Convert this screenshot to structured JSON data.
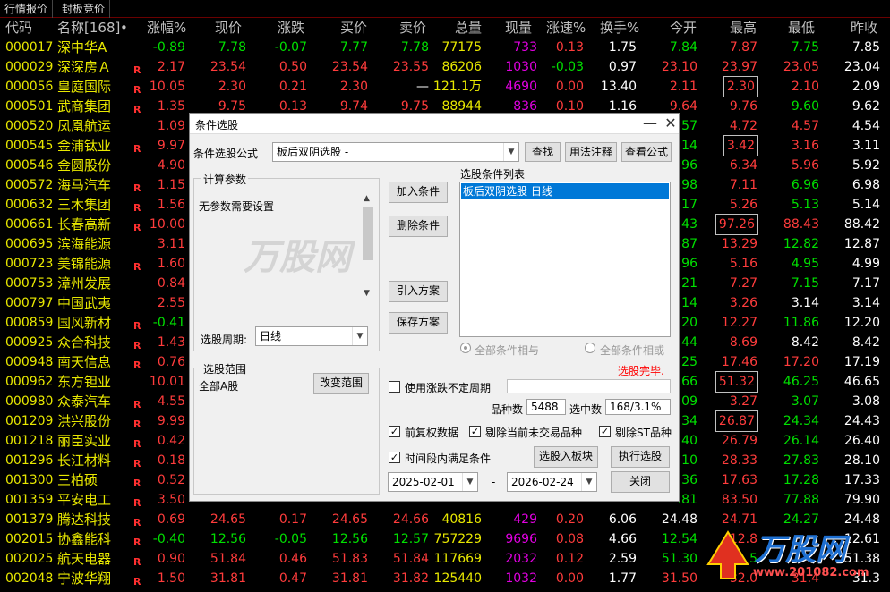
{
  "tabs": [
    "行情报价",
    "封板竞价"
  ],
  "columns": [
    "代码",
    "名称[168]",
    "涨幅%",
    "现价",
    "涨跌",
    "买价",
    "卖价",
    "总量",
    "现量",
    "涨速%",
    "换手%",
    "今开",
    "最高",
    "最低",
    "昨收"
  ],
  "name_dot": "•",
  "rows": [
    {
      "code": "000017",
      "name": "深中华A",
      "r": "",
      "chg": "-0.89",
      "price": "7.78",
      "diff": "-0.07",
      "bid": "7.77",
      "ask": "7.78",
      "vol": "77175",
      "cur": "733",
      "speed": "0.13",
      "turn": "1.75",
      "open": "7.84",
      "high": "7.87",
      "low": "7.75",
      "prev": "7.85"
    },
    {
      "code": "000029",
      "name": "深深房Ａ",
      "r": "R",
      "chg": "2.17",
      "price": "23.54",
      "diff": "0.50",
      "bid": "23.54",
      "ask": "23.55",
      "vol": "86206",
      "cur": "1030",
      "speed": "-0.03",
      "turn": "0.97",
      "open": "23.10",
      "high": "23.97",
      "low": "23.05",
      "prev": "23.04"
    },
    {
      "code": "000056",
      "name": "皇庭国际",
      "r": "R",
      "chg": "10.05",
      "price": "2.30",
      "diff": "0.21",
      "bid": "2.30",
      "ask": "—",
      "vol": "121.1万",
      "cur": "4690",
      "speed": "0.00",
      "turn": "13.40",
      "open": "2.11",
      "high": "2.30",
      "low": "2.10",
      "prev": "2.09"
    },
    {
      "code": "000501",
      "name": "武商集团",
      "r": "R",
      "chg": "1.35",
      "price": "9.75",
      "diff": "0.13",
      "bid": "9.74",
      "ask": "9.75",
      "vol": "88944",
      "cur": "836",
      "speed": "0.10",
      "turn": "1.16",
      "open": "9.64",
      "high": "9.76",
      "low": "9.60",
      "prev": "9.62"
    },
    {
      "code": "000520",
      "name": "凤凰航运",
      "r": "",
      "chg": "1.09",
      "price": "",
      "diff": "",
      "bid": "",
      "ask": "",
      "vol": "",
      "cur": "",
      "speed": "",
      "turn": "",
      "open": ".57",
      "high": "4.72",
      "low": "4.57",
      "prev": "4.54"
    },
    {
      "code": "000545",
      "name": "金浦钛业",
      "r": "R",
      "chg": "9.97",
      "price": "",
      "diff": "",
      "bid": "",
      "ask": "",
      "vol": "",
      "cur": "",
      "speed": "",
      "turn": "",
      "open": ".14",
      "high": "3.42",
      "low": "3.16",
      "prev": "3.11"
    },
    {
      "code": "000546",
      "name": "金圆股份",
      "r": "",
      "chg": "4.90",
      "price": "",
      "diff": "",
      "bid": "",
      "ask": "",
      "vol": "",
      "cur": "",
      "speed": "",
      "turn": "",
      "open": ".96",
      "high": "6.34",
      "low": "5.96",
      "prev": "5.92"
    },
    {
      "code": "000572",
      "name": "海马汽车",
      "r": "R",
      "chg": "1.15",
      "price": "",
      "diff": "",
      "bid": "",
      "ask": "",
      "vol": "",
      "cur": "",
      "speed": "",
      "turn": "",
      "open": ".98",
      "high": "7.11",
      "low": "6.96",
      "prev": "6.98"
    },
    {
      "code": "000632",
      "name": "三木集团",
      "r": "R",
      "chg": "1.56",
      "price": "",
      "diff": "",
      "bid": "",
      "ask": "",
      "vol": "",
      "cur": "",
      "speed": "",
      "turn": "",
      "open": ".17",
      "high": "5.26",
      "low": "5.13",
      "prev": "5.14"
    },
    {
      "code": "000661",
      "name": "长春高新",
      "r": "R",
      "chg": "10.00",
      "price": "",
      "diff": "",
      "bid": "",
      "ask": "",
      "vol": "",
      "cur": "",
      "speed": "",
      "turn": "",
      "open": ".43",
      "high": "97.26",
      "low": "88.43",
      "prev": "88.42"
    },
    {
      "code": "000695",
      "name": "滨海能源",
      "r": "",
      "chg": "3.11",
      "price": "",
      "diff": "",
      "bid": "",
      "ask": "",
      "vol": "",
      "cur": "",
      "speed": "",
      "turn": "",
      "open": ".87",
      "high": "13.29",
      "low": "12.82",
      "prev": "12.87"
    },
    {
      "code": "000723",
      "name": "美锦能源",
      "r": "R",
      "chg": "1.60",
      "price": "",
      "diff": "",
      "bid": "",
      "ask": "",
      "vol": "",
      "cur": "",
      "speed": "",
      "turn": "",
      "open": ".96",
      "high": "5.16",
      "low": "4.95",
      "prev": "4.99"
    },
    {
      "code": "000753",
      "name": "漳州发展",
      "r": "",
      "chg": "0.84",
      "price": "",
      "diff": "",
      "bid": "",
      "ask": "",
      "vol": "",
      "cur": "",
      "speed": "",
      "turn": "",
      "open": ".21",
      "high": "7.27",
      "low": "7.15",
      "prev": "7.17"
    },
    {
      "code": "000797",
      "name": "中国武夷",
      "r": "",
      "chg": "2.55",
      "price": "",
      "diff": "",
      "bid": "",
      "ask": "",
      "vol": "",
      "cur": "",
      "speed": "",
      "turn": "",
      "open": ".14",
      "high": "3.26",
      "low": "3.14",
      "prev": "3.14"
    },
    {
      "code": "000859",
      "name": "国风新材",
      "r": "R",
      "chg": "-0.41",
      "price": "",
      "diff": "",
      "bid": "",
      "ask": "",
      "vol": "",
      "cur": "",
      "speed": "",
      "turn": "",
      "open": ".20",
      "high": "12.27",
      "low": "11.86",
      "prev": "12.20"
    },
    {
      "code": "000925",
      "name": "众合科技",
      "r": "R",
      "chg": "1.43",
      "price": "",
      "diff": "",
      "bid": "",
      "ask": "",
      "vol": "",
      "cur": "",
      "speed": "",
      "turn": "",
      "open": ".44",
      "high": "8.69",
      "low": "8.42",
      "prev": "8.42"
    },
    {
      "code": "000948",
      "name": "南天信息",
      "r": "R",
      "chg": "0.76",
      "price": "",
      "diff": "",
      "bid": "",
      "ask": "",
      "vol": "",
      "cur": "",
      "speed": "",
      "turn": "",
      "open": ".25",
      "high": "17.46",
      "low": "17.20",
      "prev": "17.19"
    },
    {
      "code": "000962",
      "name": "东方钽业",
      "r": "",
      "chg": "10.01",
      "price": "",
      "diff": "",
      "bid": "",
      "ask": "",
      "vol": "",
      "cur": "",
      "speed": "",
      "turn": "",
      "open": ".66",
      "high": "51.32",
      "low": "46.25",
      "prev": "46.65"
    },
    {
      "code": "000980",
      "name": "众泰汽车",
      "r": "R",
      "chg": "4.55",
      "price": "",
      "diff": "",
      "bid": "",
      "ask": "",
      "vol": "",
      "cur": "",
      "speed": "",
      "turn": "",
      "open": ".09",
      "high": "3.27",
      "low": "3.07",
      "prev": "3.08"
    },
    {
      "code": "001209",
      "name": "洪兴股份",
      "r": "R",
      "chg": "9.99",
      "price": "",
      "diff": "",
      "bid": "",
      "ask": "",
      "vol": "",
      "cur": "",
      "speed": "",
      "turn": "",
      "open": ".34",
      "high": "26.87",
      "low": "24.34",
      "prev": "24.43"
    },
    {
      "code": "001218",
      "name": "丽臣实业",
      "r": "R",
      "chg": "0.42",
      "price": "",
      "diff": "",
      "bid": "",
      "ask": "",
      "vol": "",
      "cur": "",
      "speed": "",
      "turn": "",
      "open": ".40",
      "high": "26.79",
      "low": "26.14",
      "prev": "26.40"
    },
    {
      "code": "001296",
      "name": "长江材料",
      "r": "R",
      "chg": "0.18",
      "price": "",
      "diff": "",
      "bid": "",
      "ask": "",
      "vol": "",
      "cur": "",
      "speed": "",
      "turn": "",
      "open": ".10",
      "high": "28.33",
      "low": "27.83",
      "prev": "28.10"
    },
    {
      "code": "001300",
      "name": "三柏硕",
      "r": "R",
      "chg": "0.52",
      "price": "",
      "diff": "",
      "bid": "",
      "ask": "",
      "vol": "",
      "cur": "",
      "speed": "",
      "turn": "",
      "open": ".36",
      "high": "17.63",
      "low": "17.28",
      "prev": "17.33"
    },
    {
      "code": "001359",
      "name": "平安电工",
      "r": "R",
      "chg": "3.50",
      "price": "",
      "diff": "",
      "bid": "",
      "ask": "",
      "vol": "",
      "cur": "",
      "speed": "",
      "turn": "",
      "open": ".81",
      "high": "83.50",
      "low": "77.88",
      "prev": "79.90"
    },
    {
      "code": "001379",
      "name": "腾达科技",
      "r": "R",
      "chg": "0.69",
      "price": "24.65",
      "diff": "0.17",
      "bid": "24.65",
      "ask": "24.66",
      "vol": "40816",
      "cur": "429",
      "speed": "0.20",
      "turn": "6.06",
      "open": "24.48",
      "high": "24.71",
      "low": "24.27",
      "prev": "24.48"
    },
    {
      "code": "002015",
      "name": "协鑫能科",
      "r": "R",
      "chg": "-0.40",
      "price": "12.56",
      "diff": "-0.05",
      "bid": "12.56",
      "ask": "12.57",
      "vol": "757229",
      "cur": "9696",
      "speed": "0.08",
      "turn": "4.66",
      "open": "12.54",
      "high": "12.8",
      "low": "",
      "prev": "12.61"
    },
    {
      "code": "002025",
      "name": "航天电器",
      "r": "R",
      "chg": "0.90",
      "price": "51.84",
      "diff": "0.46",
      "bid": "51.83",
      "ask": "51.84",
      "vol": "117669",
      "cur": "2032",
      "speed": "0.12",
      "turn": "2.59",
      "open": "51.30",
      "high": "5",
      "low": "",
      "prev": "51.38"
    },
    {
      "code": "002048",
      "name": "宁波华翔",
      "r": "R",
      "chg": "1.50",
      "price": "31.81",
      "diff": "0.47",
      "bid": "31.81",
      "ask": "31.82",
      "vol": "125440",
      "cur": "1032",
      "speed": "0.00",
      "turn": "1.77",
      "open": "31.50",
      "high": "32.0",
      "low": "31.4",
      "prev": "31.3"
    }
  ],
  "dialog": {
    "title": "条件选股",
    "minimize": "—",
    "close": "✕",
    "formula_label": "条件选股公式",
    "formula_value": "板后双阴选股  -",
    "btn_find": "查找",
    "btn_usage": "用法注释",
    "btn_view": "查看公式",
    "calc_params": "计算参数",
    "no_params": "无参数需要设置",
    "list_title": "选股条件列表",
    "list_item": "板后双阴选股  日线",
    "btn_add": "加入条件",
    "btn_del": "删除条件",
    "btn_import": "引入方案",
    "btn_save": "保存方案",
    "period_label": "选股周期:",
    "period_value": "日线",
    "radio_and": "全部条件相与",
    "radio_or": "全部条件相或",
    "status": "选股完毕.",
    "range_title": "选股范围",
    "range_value": "全部A股",
    "btn_range": "改变范围",
    "chk_uncertain": "使用涨跌不定周期",
    "count_label": "品种数",
    "count_value": "5488",
    "picked_label": "选中数",
    "picked_value": "168/3.1%",
    "chk_fq": "前复权数据",
    "chk_unlisted": "剔除当前未交易品种",
    "chk_st": "剔除ST品种",
    "chk_period": "时间段内满足条件",
    "btn_block": "选股入板块",
    "btn_run": "执行选股",
    "date_from": "2025-02-01",
    "date_sep": "-",
    "date_to": "2026-02-24",
    "btn_close": "关闭",
    "check": "✓"
  },
  "watermark": {
    "brand": "万股网",
    "url": "www.201082.com"
  },
  "colors": {
    "up": "#ff3c3c",
    "down": "#00e000",
    "code": "#e8e800",
    "selected": "#0078d7",
    "status": "#ff0000"
  }
}
